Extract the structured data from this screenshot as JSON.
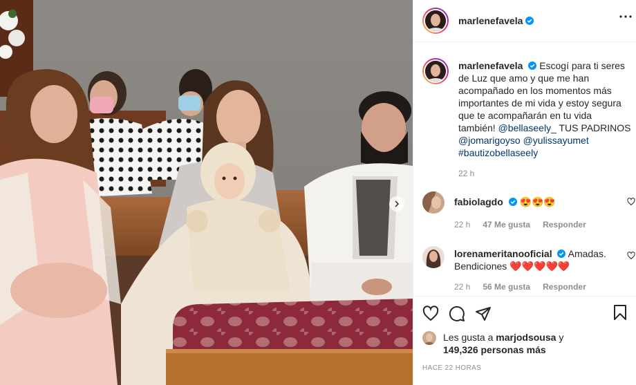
{
  "post": {
    "author": "marlenefavela",
    "verified": true
  },
  "caption": {
    "username": "marlenefavela",
    "text_1": "Escogí para ti seres de Luz que amo y que me han acompañado en los momentos más importantes de mi vida y estoy segura que te acompañarán en tu vida también!",
    "mention_1": "@bellaseely_",
    "text_2": "TUS PADRINOS",
    "mention_2": "@jomarigoyso",
    "mention_3": "@yulissayumet",
    "hashtag": "#bautizobellaseely",
    "time": "22 h"
  },
  "comments": [
    {
      "username": "fabiolagdo",
      "verified": true,
      "text": "😍😍😍",
      "time": "22 h",
      "likes": "47 Me gusta",
      "reply": "Responder"
    },
    {
      "username": "lorenameritanooficial",
      "verified": true,
      "text": "Amadas. Bendiciones ❤️❤️❤️❤️❤️",
      "time": "22 h",
      "likes": "56 Me gusta",
      "reply": "Responder"
    }
  ],
  "likes": {
    "prefix": "Les gusta a",
    "user": "marjodsousa",
    "joiner": "y",
    "count": "149,326 personas más"
  },
  "posted_ago": "HACE 22 HORAS",
  "icons": [
    "more-icon",
    "heart-icon",
    "comment-icon",
    "share-icon",
    "save-icon",
    "verified-icon",
    "chevron-right-icon"
  ],
  "colors": {
    "link": "#00376b",
    "secondary": "#8e8e8e",
    "verified": "#0095f6",
    "border": "#efefef"
  }
}
